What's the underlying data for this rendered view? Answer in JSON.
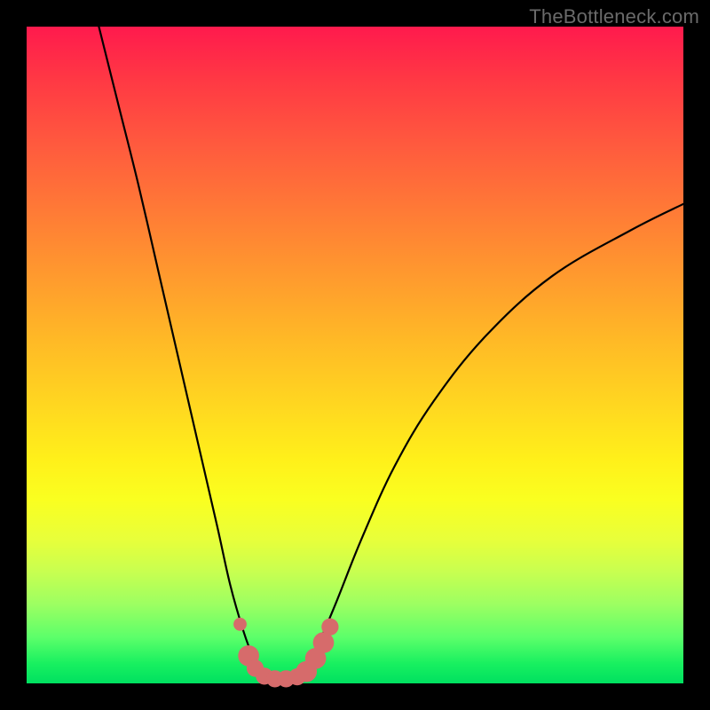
{
  "watermark": "TheBottleneck.com",
  "colors": {
    "curve": "#000000",
    "marker_fill": "#d66b6b",
    "marker_stroke": "#c95b5b",
    "gradient_top": "#ff1a4d",
    "gradient_bottom": "#00e060",
    "frame": "#000000"
  },
  "chart_data": {
    "type": "line",
    "title": "",
    "xlabel": "",
    "ylabel": "",
    "xlim": [
      0,
      100
    ],
    "ylim": [
      0,
      100
    ],
    "grid": false,
    "series": [
      {
        "name": "curve-left",
        "x": [
          11,
          14,
          17,
          20,
          23,
          26,
          29,
          31,
          33,
          34.5,
          36
        ],
        "y": [
          100,
          88,
          76,
          63,
          50,
          37,
          24,
          15,
          8,
          4,
          1.5
        ]
      },
      {
        "name": "curve-right",
        "x": [
          42,
          44,
          47,
          51,
          56,
          62,
          70,
          80,
          92,
          100
        ],
        "y": [
          1.5,
          5,
          12,
          22,
          33,
          43,
          53,
          62,
          69,
          73
        ]
      }
    ],
    "markers": {
      "name": "bottom-dots",
      "points": [
        {
          "x": 32.5,
          "y": 9.0,
          "r": 1.0
        },
        {
          "x": 33.8,
          "y": 4.2,
          "r": 1.6
        },
        {
          "x": 34.8,
          "y": 2.3,
          "r": 1.3
        },
        {
          "x": 36.2,
          "y": 1.1,
          "r": 1.3
        },
        {
          "x": 37.8,
          "y": 0.7,
          "r": 1.3
        },
        {
          "x": 39.5,
          "y": 0.7,
          "r": 1.3
        },
        {
          "x": 41.2,
          "y": 1.0,
          "r": 1.3
        },
        {
          "x": 42.6,
          "y": 1.8,
          "r": 1.6
        },
        {
          "x": 44.0,
          "y": 3.8,
          "r": 1.6
        },
        {
          "x": 45.2,
          "y": 6.2,
          "r": 1.6
        },
        {
          "x": 46.2,
          "y": 8.6,
          "r": 1.3
        }
      ]
    }
  }
}
